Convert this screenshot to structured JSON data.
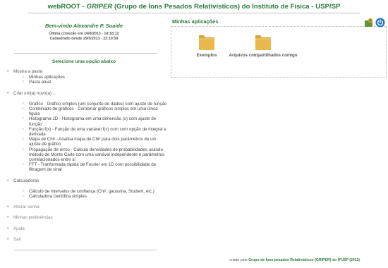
{
  "header": {
    "brand": "webROOT",
    "dash": " - ",
    "griper": "GRIPER",
    "rest": " (Grupo de Íons Pesados Relativísticos) do Instituto de Física - USP/SP"
  },
  "user": {
    "welcome": "Bem-vindo Alexandre P. Suaide",
    "last_login": "Última conexão em 16/8/2013 - 14:18:12",
    "registered": "Cadastrado desde 29/5/2013 - 22:19:59"
  },
  "menu": {
    "heading": "Selecione uma opção abaixo",
    "sections": [
      {
        "label": "Mostra a pasta",
        "items": [
          "Minhas aplicações",
          "Pasta atual"
        ]
      },
      {
        "label": "Criar um(a) novo(a) ...",
        "items": [
          "Gráfico - Gráfico simples (um conjunto de dados) com ajuste de função",
          "Combinado de gráficos - Combinar gráficos simples em uma única figura",
          "Histograma 1D - Histograma em uma dimensão (x) com ajuste de função",
          "Função f(x) - Função de uma variável f(x) com com opção de integral e derivada",
          "Mapa de Chi² - Analisa mapa de Chi² para dois parâmetros de um ajuste de gráfico",
          "Propagação de erros - Calcula densidades de probabilidades usando método de Monte Carlo com uma variável independente e parâmetros correlacionados entre si",
          "FFT - Tranformada rápida de Fourier em 1D com possibilidade de filtragem de sinal"
        ]
      },
      {
        "label": "Calculadoras",
        "items": [
          "Cálculo de intervalos de confiança (Chi², gaussina, Student, etc.)",
          "Calculadora científica simples"
        ]
      }
    ],
    "links": [
      "Alterar senha",
      "Minhas preferências",
      "Ajuda",
      "Sair"
    ]
  },
  "apps": {
    "title": "Minhas aplicações",
    "folders": [
      {
        "label": "Exemplos",
        "icon": "folder-icon"
      },
      {
        "label": "Arquivos compartilhados comigo",
        "icon": "folder-icon"
      }
    ]
  },
  "toolbar": {
    "settings_icon": "gear-icon",
    "logout_icon": "power-icon"
  },
  "footer": {
    "prefix": "criado pelo ",
    "org": "Grupo de Íons pesados Relativísticos (GRIPER) do IFUSP (2011)"
  },
  "colors": {
    "accent_green": "#2c7a3a",
    "folder_yellow": "#e8b84a",
    "power_blue": "#1e73c8"
  }
}
